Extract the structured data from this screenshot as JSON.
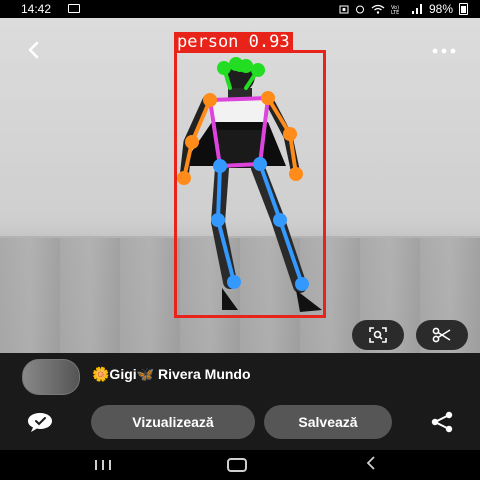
{
  "status_bar": {
    "time": "14:42",
    "battery": "98%",
    "icons": [
      "gallery-icon",
      "photo-icon",
      "alarm-icon",
      "wifi-icon",
      "volte-icon",
      "signal-icon",
      "battery-icon"
    ]
  },
  "viewer": {
    "back_icon": "chevron-left-icon",
    "more_icon": "more-horizontal-icon",
    "detection": {
      "label": "person 0.93",
      "color": "#e8241a"
    },
    "pose_colors": {
      "head": "#22dd22",
      "arms": "#ff8c1a",
      "torso": "#dd44dd",
      "legs": "#3399ff"
    },
    "lens_icon": "visual-search-icon",
    "cut_icon": "scissors-icon"
  },
  "author": {
    "name": "🌼Gigi🦋 Rivera Mundo"
  },
  "actions": {
    "comment_icon": "comment-icon",
    "view_label": "Vizualizează",
    "save_label": "Salvează",
    "share_icon": "share-icon"
  },
  "nav": {
    "recents_icon": "recents-icon",
    "home_icon": "home-icon",
    "back_icon": "back-icon"
  }
}
